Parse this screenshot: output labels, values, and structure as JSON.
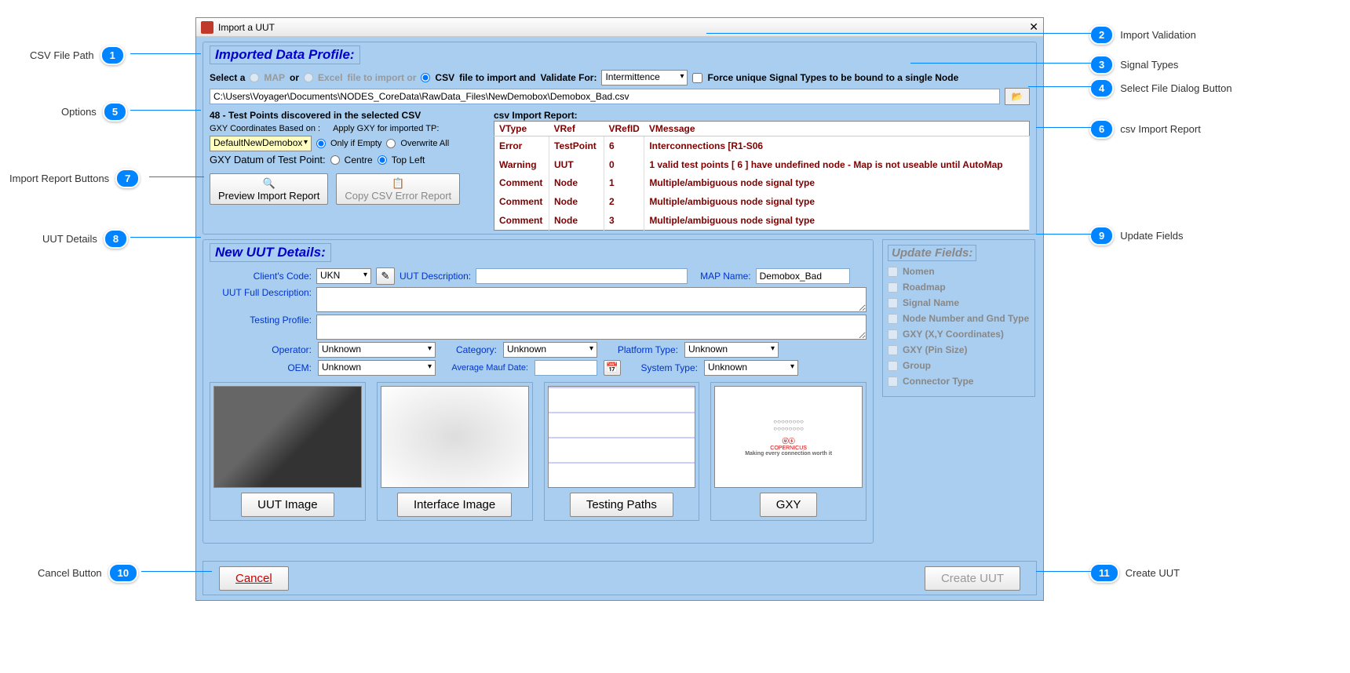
{
  "window": {
    "title": "Import a UUT"
  },
  "profile": {
    "title": "Imported Data Profile:",
    "select_a": "Select a",
    "map_label": "MAP",
    "or1": "or",
    "excel_label": "Excel",
    "file_to_import_or": "file to import or",
    "csv_label": "CSV",
    "file_to_import_and": "file to import and",
    "validate_for": "Validate For:",
    "validate_value": "Intermittence",
    "force_unique": "Force unique Signal Types to be bound to a single Node",
    "file_path": "C:\\Users\\Voyager\\Documents\\NODES_CoreData\\RawData_Files\\NewDemobox\\Demobox_Bad.csv"
  },
  "options": {
    "tp_discovered": "48 - Test Points discovered in the selected CSV",
    "gxy_based": "GXY Coordinates Based on :",
    "apply_gxy": "Apply GXY for imported TP:",
    "gxy_value": "DefaultNewDemobox",
    "only_if_empty": "Only if Empty",
    "overwrite_all": "Overwrite All",
    "gxy_datum": "GXY Datum of Test Point:",
    "centre": "Centre",
    "top_left": "Top Left",
    "preview_btn": "Preview Import Report",
    "copy_btn": "Copy CSV Error Report"
  },
  "report": {
    "title": "csv Import Report:",
    "cols": [
      "VType",
      "VRef",
      "VRefID",
      "VMessage"
    ],
    "rows": [
      [
        "Error",
        "TestPoint",
        "6",
        "Interconnections [R1-S06"
      ],
      [
        "Warning",
        "UUT",
        "0",
        "1 valid test points [ 6 ] have undefined node - Map is not useable until AutoMap"
      ],
      [
        "Comment",
        "Node",
        "1",
        "Multiple/ambiguous node signal type"
      ],
      [
        "Comment",
        "Node",
        "2",
        "Multiple/ambiguous node signal type"
      ],
      [
        "Comment",
        "Node",
        "3",
        "Multiple/ambiguous node signal type"
      ]
    ]
  },
  "details": {
    "title": "New UUT Details:",
    "clients_code": "Client's Code:",
    "clients_code_val": "UKN",
    "uut_desc": "UUT Description:",
    "map_name": "MAP Name:",
    "map_name_val": "Demobox_Bad",
    "full_desc": "UUT Full Description:",
    "testing_profile": "Testing Profile:",
    "operator": "Operator:",
    "category": "Category:",
    "platform_type": "Platform Type:",
    "oem": "OEM:",
    "avg_mauf": "Average Mauf Date:",
    "system_type": "System Type:",
    "unknown": "Unknown"
  },
  "thumbs": {
    "uut_image": "UUT Image",
    "interface_image": "Interface Image",
    "testing_paths": "Testing Paths",
    "gxy": "GXY",
    "gxy_tagline": "Making every connection worth it"
  },
  "update": {
    "title": "Update Fields:",
    "items": [
      "Nomen",
      "Roadmap",
      "Signal Name",
      "Node Number and Gnd Type",
      "GXY (X,Y Coordinates)",
      "GXY (Pin Size)",
      "Group",
      "Connector Type"
    ]
  },
  "bottom": {
    "cancel": "Cancel",
    "create": "Create UUT"
  },
  "callouts": {
    "1": "CSV File Path",
    "2": "Import Validation",
    "3": "Signal Types",
    "4": "Select File Dialog Button",
    "5": "Options",
    "6": "csv Import Report",
    "7": "Import Report Buttons",
    "8": "UUT Details",
    "9": "Update Fields",
    "10": "Cancel Button",
    "11": "Create UUT"
  }
}
